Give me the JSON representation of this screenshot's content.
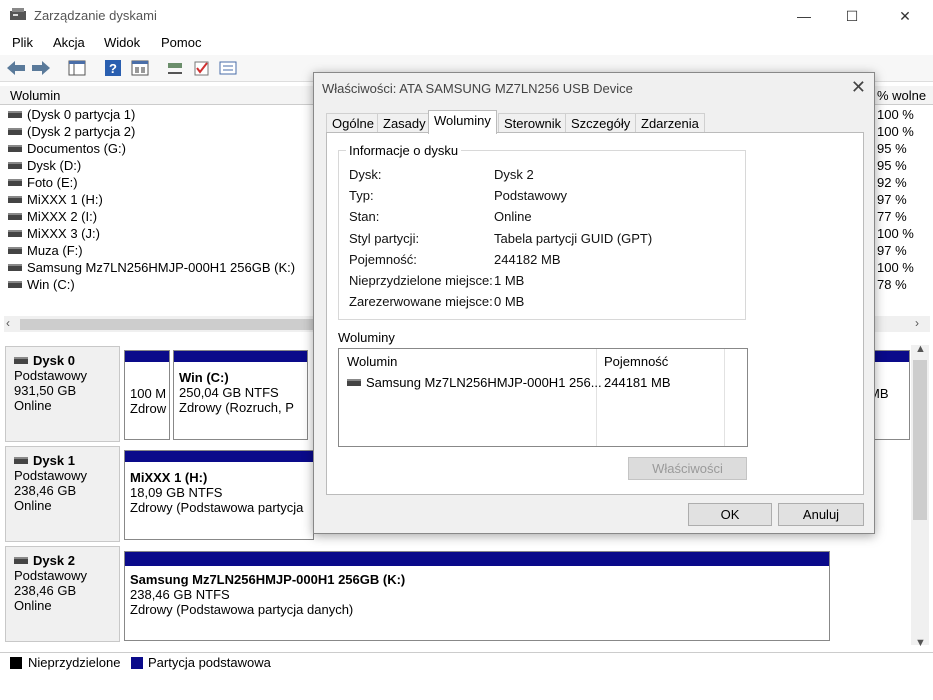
{
  "window": {
    "title": "Zarządzanie dyskami",
    "minimize": "—",
    "maximize": "☐",
    "close": "✕"
  },
  "menu": [
    "Plik",
    "Akcja",
    "Widok",
    "Pomoc"
  ],
  "volume_list": {
    "columns": {
      "volume": "Wolumin",
      "free_pct": "% wolne"
    },
    "rows": [
      {
        "name": "(Dysk 0 partycja 1)",
        "free": "100 %"
      },
      {
        "name": "(Dysk 2 partycja 2)",
        "free": "100 %"
      },
      {
        "name": "Documentos (G:)",
        "free": "95 %"
      },
      {
        "name": "Dysk (D:)",
        "free": "95 %"
      },
      {
        "name": "Foto (E:)",
        "free": "92 %"
      },
      {
        "name": "MiXXX 1 (H:)",
        "free": "97 %"
      },
      {
        "name": "MiXXX 2 (I:)",
        "free": "77 %"
      },
      {
        "name": "MiXXX 3 (J:)",
        "free": "100 %"
      },
      {
        "name": "Muza (F:)",
        "free": "97 %"
      },
      {
        "name": "Samsung Mz7LN256HMJP-000H1 256GB (K:)",
        "free": "100 %"
      },
      {
        "name": "Win (C:)",
        "free": "78 %"
      }
    ]
  },
  "disks": [
    {
      "name": "Dysk 0",
      "type": "Podstawowy",
      "size": "931,50 GB",
      "status": "Online",
      "parts": [
        {
          "line1": "100 M",
          "line2": "Zdrow"
        },
        {
          "title": "Win  (C:)",
          "line1": "250,04 GB NTFS",
          "line2": "Zdrowy (Rozruch, P"
        }
      ],
      "right_text": "MB"
    },
    {
      "name": "Dysk 1",
      "type": "Podstawowy",
      "size": "238,46 GB",
      "status": "Online",
      "parts": [
        {
          "title": "MiXXX 1  (H:)",
          "line1": "18,09 GB NTFS",
          "line2": "Zdrowy (Podstawowa partycja"
        }
      ]
    },
    {
      "name": "Dysk 2",
      "type": "Podstawowy",
      "size": "238,46 GB",
      "status": "Online",
      "parts": [
        {
          "title": "Samsung Mz7LN256HMJP-000H1 256GB  (K:)",
          "line1": "238,46 GB NTFS",
          "line2": "Zdrowy (Podstawowa partycja danych)"
        }
      ]
    }
  ],
  "legend": {
    "unallocated": "Nieprzydzielone",
    "primary": "Partycja podstawowa"
  },
  "colors": {
    "unallocated": "#000000",
    "primary": "#0a0a8a"
  },
  "dialog": {
    "title": "Właściwości: ATA SAMSUNG MZ7LN256 USB Device",
    "tabs": [
      "Ogólne",
      "Zasady",
      "Woluminy",
      "Sterownik",
      "Szczegóły",
      "Zdarzenia"
    ],
    "active_tab": "Woluminy",
    "info_title": "Informacje o dysku",
    "info": [
      {
        "key": "Dysk:",
        "value": "Dysk 2"
      },
      {
        "key": "Typ:",
        "value": "Podstawowy"
      },
      {
        "key": "Stan:",
        "value": "Online"
      },
      {
        "key": "Styl partycji:",
        "value": "Tabela partycji GUID (GPT)"
      },
      {
        "key": "Pojemność:",
        "value": "244182 MB"
      },
      {
        "key": "Nieprzydzielone miejsce:",
        "value": "1 MB"
      },
      {
        "key": "Zarezerwowane miejsce:",
        "value": "0 MB"
      }
    ],
    "volumes_caption": "Woluminy",
    "volumes_columns": {
      "volume": "Wolumin",
      "capacity": "Pojemność"
    },
    "volumes": [
      {
        "name": "Samsung Mz7LN256HMJP-000H1 256...",
        "capacity": "244181 MB"
      }
    ],
    "buttons": {
      "properties": "Właściwości",
      "ok": "OK",
      "cancel": "Anuluj"
    }
  }
}
